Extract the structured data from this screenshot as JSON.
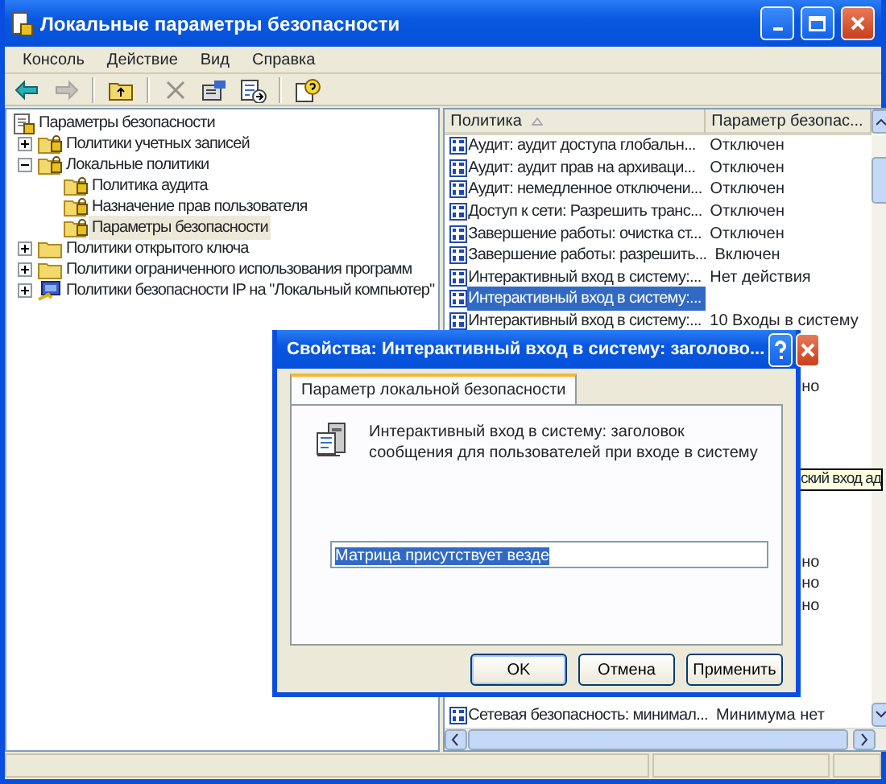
{
  "window": {
    "title": "Локальные параметры безопасности"
  },
  "menu": [
    {
      "label": "Консоль"
    },
    {
      "label": "Действие"
    },
    {
      "label": "Вид"
    },
    {
      "label": "Справка"
    }
  ],
  "toolbar": [
    {
      "kind": "back",
      "disabled": false
    },
    {
      "kind": "forward",
      "disabled": true
    },
    {
      "kind": "separator"
    },
    {
      "kind": "up",
      "disabled": false
    },
    {
      "kind": "separator"
    },
    {
      "kind": "delete",
      "disabled": true
    },
    {
      "kind": "properties",
      "disabled": false
    },
    {
      "kind": "export",
      "disabled": false
    },
    {
      "kind": "separator"
    },
    {
      "kind": "help",
      "disabled": false
    }
  ],
  "tree": {
    "label": "Параметры безопасности",
    "kind": "root",
    "selected": false,
    "children": [
      {
        "label": "Политики учетных записей",
        "kind": "secured",
        "expanded": false,
        "selected": false
      },
      {
        "label": "Локальные политики",
        "kind": "secured",
        "expanded": true,
        "selected": false,
        "children": [
          {
            "label": "Политика аудита",
            "kind": "secured",
            "selected": false
          },
          {
            "label": "Назначение прав пользователя",
            "kind": "secured",
            "selected": false
          },
          {
            "label": "Параметры безопасности",
            "kind": "secured",
            "selected": true
          }
        ]
      },
      {
        "label": "Политики открытого ключа",
        "kind": "plain",
        "expanded": false,
        "selected": false
      },
      {
        "label": "Политики ограниченного использования программ",
        "kind": "plain",
        "expanded": false,
        "selected": false
      },
      {
        "label": "Политики безопасности IP на \"Локальный компьютер\"",
        "kind": "network",
        "expanded": false,
        "selected": false
      }
    ]
  },
  "list": {
    "columns": [
      {
        "label": "Политика",
        "sorted": true
      },
      {
        "label": "Параметр безопас...",
        "sorted": false
      }
    ],
    "rows": [
      {
        "kind": "row",
        "policy": "Аудит: аудит доступа глобальн...",
        "setting": "Отключен",
        "selected": false
      },
      {
        "kind": "row",
        "policy": "Аудит: аудит прав на архиваци...",
        "setting": "Отключен",
        "selected": false
      },
      {
        "kind": "row",
        "policy": "Аудит: немедленное отключени...",
        "setting": "Отключен",
        "selected": false
      },
      {
        "kind": "row",
        "policy": "Доступ к сети: Разрешить транс...",
        "setting": "Отключен",
        "selected": false
      },
      {
        "kind": "row",
        "policy": "Завершение работы: очистка ст...",
        "setting": "Отключен",
        "selected": false
      },
      {
        "kind": "row",
        "policy": "Завершение работы: разрешить...",
        "setting": "Включен",
        "selected": false
      },
      {
        "kind": "row",
        "policy": "Интерактивный вход в систему:...",
        "setting": "Нет действия",
        "selected": false
      },
      {
        "kind": "row",
        "policy": "Интерактивный вход в систему:...",
        "selected": true
      },
      {
        "kind": "row",
        "policy": "Интерактивный вход в систему:...",
        "setting": "10 Входы в систему",
        "selected": false
      },
      {
        "kind": "covered"
      },
      {
        "kind": "covered"
      },
      {
        "kind": "covered",
        "setting_tail": "но"
      },
      {
        "kind": "covered"
      },
      {
        "kind": "covered"
      },
      {
        "kind": "covered"
      },
      {
        "kind": "covered"
      },
      {
        "kind": "covered"
      },
      {
        "kind": "covered"
      },
      {
        "kind": "covered"
      },
      {
        "kind": "covered",
        "setting_tail": "но"
      },
      {
        "kind": "covered",
        "setting_tail": "но"
      },
      {
        "kind": "covered",
        "setting_tail": "но"
      },
      {
        "kind": "covered"
      },
      {
        "kind": "covered"
      },
      {
        "kind": "covered"
      },
      {
        "kind": "covered"
      },
      {
        "kind": "row",
        "policy": "Сетевая безопасность: минимал...",
        "setting": "Минимума нет",
        "selected": false
      }
    ]
  },
  "tooltip": {
    "text": "ский вход ад"
  },
  "dialog": {
    "title": "Свойства: Интерактивный вход в систему: заголово...",
    "tabs": [
      {
        "label": "Параметр локальной безопасности",
        "selected": true
      }
    ],
    "description": "Интерактивный вход в систему: заголовок сообщения для пользователей при входе в систему",
    "value": "Матрица присутствует везде",
    "value_selected": true,
    "buttons": [
      {
        "label": "OK",
        "default": true
      },
      {
        "label": "Отмена",
        "default": false
      },
      {
        "label": "Применить",
        "default": false
      }
    ]
  }
}
